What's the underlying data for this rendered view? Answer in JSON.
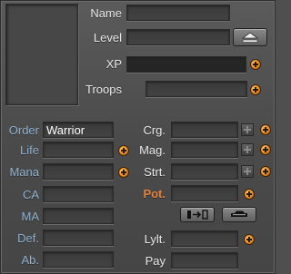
{
  "header": {
    "name_label": "Name",
    "level_label": "Level",
    "xp_label": "XP",
    "troops_label": "Troops",
    "name_value": "",
    "level_value": "",
    "xp_value": "",
    "troops_value": ""
  },
  "left_stats": {
    "order_label": "Order",
    "order_value": "Warrior",
    "life_label": "Life",
    "mana_label": "Mana",
    "ca_label": "CA",
    "ma_label": "MA",
    "def_label": "Def.",
    "ab_label": "Ab."
  },
  "right_stats": {
    "crg_label": "Crg.",
    "mag_label": "Mag.",
    "strt_label": "Strt.",
    "pot_label": "Pot.",
    "lylt_label": "Lylt.",
    "pay_label": "Pay"
  },
  "icons": {
    "level_up": "triangle-up-eject-icon",
    "plus": "orange-plus-circle-icon",
    "plus_disabled": "gray-plus-square-icon",
    "equip": "arrow-transfer-icon",
    "vehicle": "vehicle-icon"
  },
  "colors": {
    "accent_plus": "#e0851a",
    "blue_label": "#8fb0cf",
    "orange_label": "#e3803c"
  }
}
